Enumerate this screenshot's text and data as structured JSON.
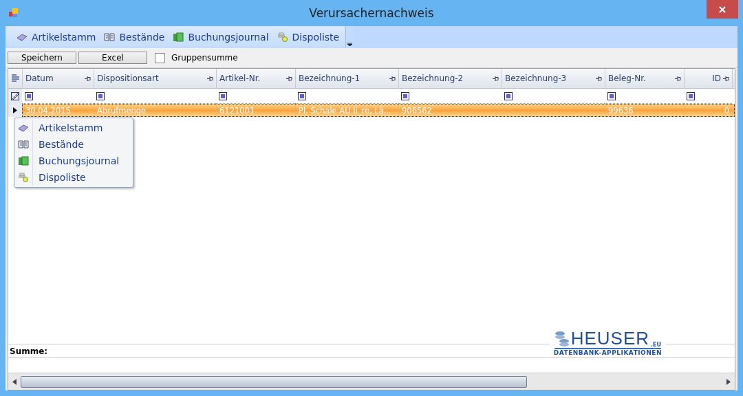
{
  "window": {
    "title": "Verursachernachweis"
  },
  "toolbar": {
    "items": [
      {
        "label": "Artikelstamm"
      },
      {
        "label": "Bestände"
      },
      {
        "label": "Buchungsjournal"
      },
      {
        "label": "Dispoliste"
      }
    ]
  },
  "actions": {
    "buttons": [
      "Speichern",
      "Excel"
    ],
    "group_sum": {
      "label": "Gruppensumme",
      "checked": false
    }
  },
  "table": {
    "columns": [
      {
        "label": "Datum",
        "kind": "text"
      },
      {
        "label": "Dispositionsart",
        "kind": "text"
      },
      {
        "label": "Artikel-Nr.",
        "kind": "text"
      },
      {
        "label": "Bezeichnung-1",
        "kind": "text"
      },
      {
        "label": "Bezeichnung-2",
        "kind": "text"
      },
      {
        "label": "Bezeichnung-3",
        "kind": "text"
      },
      {
        "label": "Beleg-Nr.",
        "kind": "text"
      },
      {
        "label": "ID",
        "kind": "numeric"
      }
    ],
    "rows": [
      {
        "selected": true,
        "cells": [
          "30.04.2015",
          "Abrufmenge",
          "6121001",
          "Pl. Schale AU li_re, Lä...",
          "906562",
          null,
          "99636",
          "0"
        ]
      }
    ]
  },
  "context_menu": {
    "items": [
      {
        "label": "Artikelstamm"
      },
      {
        "label": "Bestände"
      },
      {
        "label": "Buchungsjournal"
      },
      {
        "label": "Dispoliste"
      }
    ]
  },
  "logo": {
    "name": "HEUSER",
    "suffix": ".EU",
    "tagline": "DATENBANK-APPLIKATIONEN"
  },
  "summary": {
    "label": "Summe:"
  }
}
